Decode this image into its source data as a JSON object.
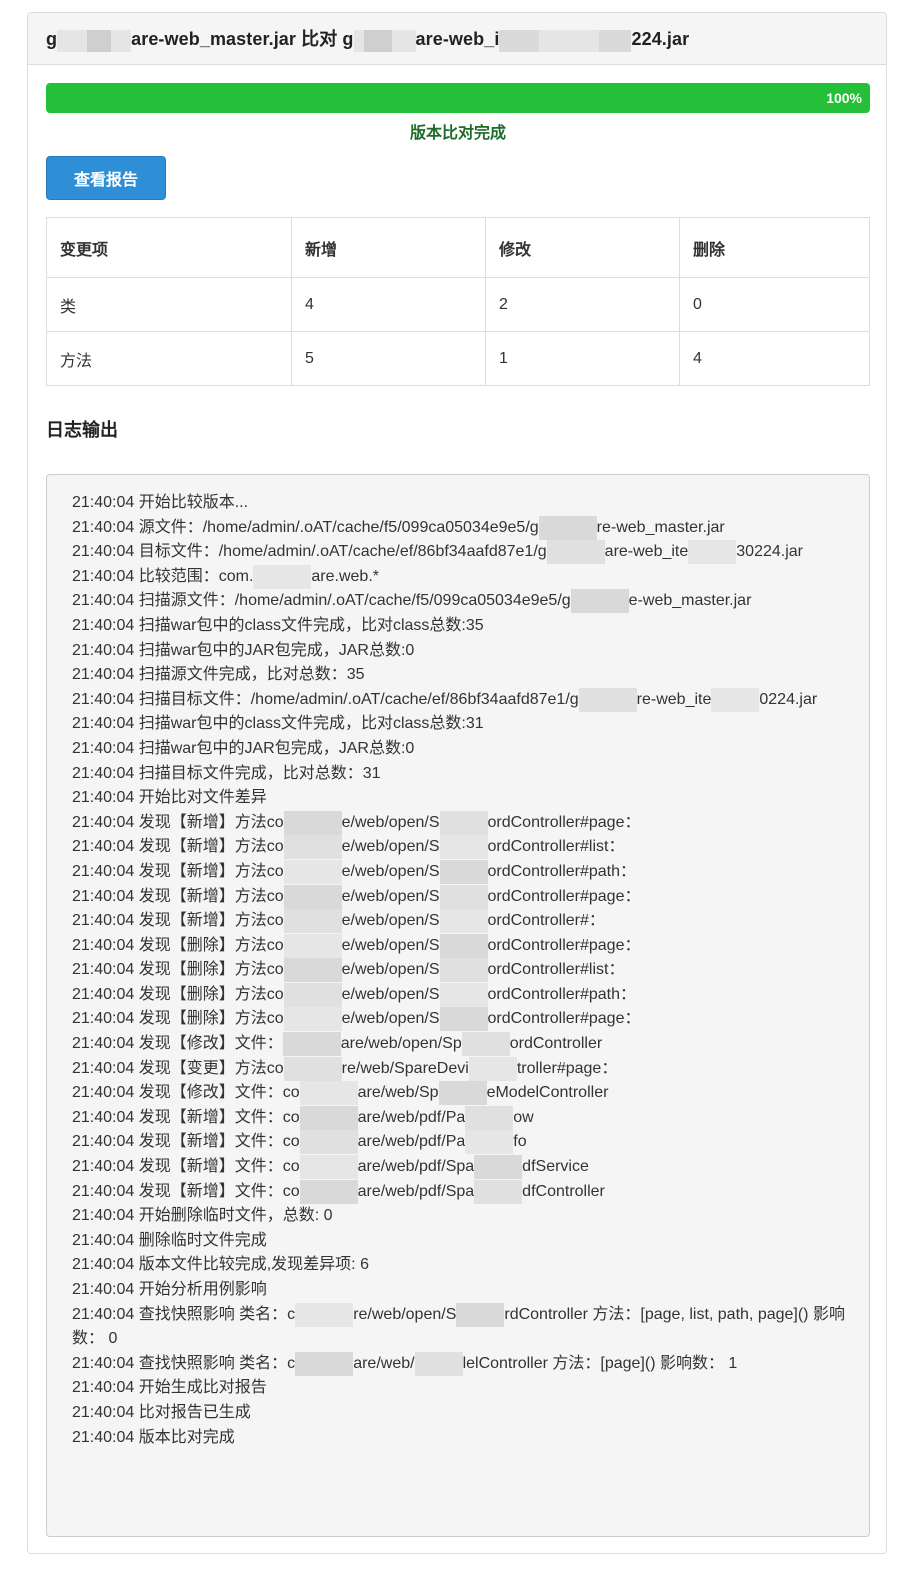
{
  "header": {
    "title_parts": [
      "g",
      "are-web_master.jar 比对 g",
      "are-web_i",
      "224.jar"
    ]
  },
  "progress": {
    "percent": 100,
    "label": "100%",
    "status": "版本比对完成",
    "color": "#24c03a"
  },
  "actions": {
    "view_report": "查看报告"
  },
  "summary_table": {
    "headers": [
      "变更项",
      "新增",
      "修改",
      "删除"
    ],
    "rows": [
      [
        "类",
        "4",
        "2",
        "0"
      ],
      [
        "方法",
        "5",
        "1",
        "4"
      ]
    ]
  },
  "log": {
    "title": "日志输出",
    "lines": [
      "21:40:04 开始比较版本...",
      "21:40:04 源文件：/home/admin/.oAT/cache/f5/099ca05034e9e5/g|||re-web_master.jar",
      "21:40:04 目标文件：/home/admin/.oAT/cache/ef/86bf34aafd87e1/g|||are-web_ite|||30224.jar",
      "21:40:04 比较范围：com.|||are.web.*",
      "21:40:04 扫描源文件：/home/admin/.oAT/cache/f5/099ca05034e9e5/g|||e-web_master.jar",
      "21:40:04 扫描war包中的class文件完成，比对class总数:35",
      "21:40:04 扫描war包中的JAR包完成，JAR总数:0",
      "21:40:04 扫描源文件完成，比对总数：35",
      "21:40:04 扫描目标文件：/home/admin/.oAT/cache/ef/86bf34aafd87e1/g|||re-web_ite|||0224.jar",
      "21:40:04 扫描war包中的class文件完成，比对class总数:31",
      "21:40:04 扫描war包中的JAR包完成，JAR总数:0",
      "21:40:04 扫描目标文件完成，比对总数：31",
      "21:40:04 开始比对文件差异",
      "21:40:04 发现【新增】方法co|||e/web/open/S|||ordController#page：",
      "21:40:04 发现【新增】方法co|||e/web/open/S|||ordController#list：",
      "21:40:04 发现【新增】方法co|||e/web/open/S|||ordController#path：",
      "21:40:04 发现【新增】方法co|||e/web/open/S|||ordController#page：",
      "21:40:04 发现【新增】方法co|||e/web/open/S|||ordController#：",
      "21:40:04 发现【删除】方法co|||e/web/open/S|||ordController#page：",
      "21:40:04 发现【删除】方法co|||e/web/open/S|||ordController#list：",
      "21:40:04 发现【删除】方法co|||e/web/open/S|||ordController#path：",
      "21:40:04 发现【删除】方法co|||e/web/open/S|||ordController#page：",
      "21:40:04 发现【修改】文件：|||are/web/open/Sp|||ordController",
      "21:40:04 发现【变更】方法co|||re/web/SpareDevi|||troller#page：",
      "21:40:04 发现【修改】文件：co|||are/web/Sp|||eModelController",
      "21:40:04 发现【新增】文件：co|||are/web/pdf/Pa|||ow",
      "21:40:04 发现【新增】文件：co|||are/web/pdf/Pa|||fo",
      "21:40:04 发现【新增】文件：co|||are/web/pdf/Spa|||dfService",
      "21:40:04 发现【新增】文件：co|||are/web/pdf/Spa|||dfController",
      "21:40:04 开始删除临时文件，总数: 0",
      "21:40:04 删除临时文件完成",
      "21:40:04 版本文件比较完成,发现差异项: 6",
      "21:40:04 开始分析用例影响",
      "21:40:04 查找快照影响 类名：c|||re/web/open/S|||rdController 方法：[page, list, path, page]() 影响数： 0",
      "21:40:04 查找快照影响 类名：c|||are/web/|||lelController 方法：[page]() 影响数： 1",
      "21:40:04 开始生成比对报告",
      "21:40:04 比对报告已生成",
      "21:40:04 版本比对完成"
    ]
  }
}
